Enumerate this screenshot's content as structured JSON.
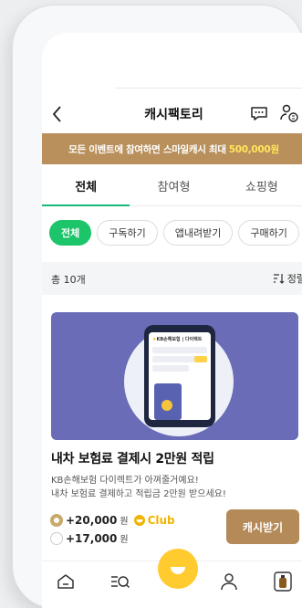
{
  "header": {
    "title": "캐시팩토리"
  },
  "banner": {
    "text": "모든 이벤트에 참여하면 스마일캐시 최대",
    "amount": "500,000원"
  },
  "tabs": [
    {
      "label": "전체",
      "active": true
    },
    {
      "label": "참여형",
      "active": false
    },
    {
      "label": "쇼핑형",
      "active": false
    }
  ],
  "chips": [
    {
      "label": "전체",
      "active": true
    },
    {
      "label": "구독하기",
      "active": false
    },
    {
      "label": "앱내려받기",
      "active": false
    },
    {
      "label": "구매하기",
      "active": false
    }
  ],
  "list": {
    "count": "총 10개",
    "sort_label": "정렬"
  },
  "card": {
    "image_brand": "KB손해보험",
    "image_brand_sub": "다이렉트",
    "title": "내차 보험료 결제시 2만원 적립",
    "desc_line1": "KB손해보험 다이렉트가 아껴줄거예요!",
    "desc_line2": "내차 보험료 결제하고 적립금 2만원 받으세요!",
    "option1_amount": "+20,000",
    "option1_unit": "원",
    "club_label": "Club",
    "option2_amount": "+17,000",
    "option2_unit": "원",
    "cta_label": "캐시받기"
  },
  "colors": {
    "accent_green": "#1cc56a",
    "brand_gold": "#b9905c",
    "highlight_yellow": "#ffe65a",
    "club_yellow": "#f0b400"
  },
  "icons": {
    "back": "chevron-left-icon",
    "chat": "chat-bubble-icon",
    "profile": "person-cash-icon",
    "home": "home-icon",
    "menu": "menu-search-icon",
    "smile": "smile-icon",
    "user": "user-icon",
    "bottle": "bottle-icon"
  }
}
